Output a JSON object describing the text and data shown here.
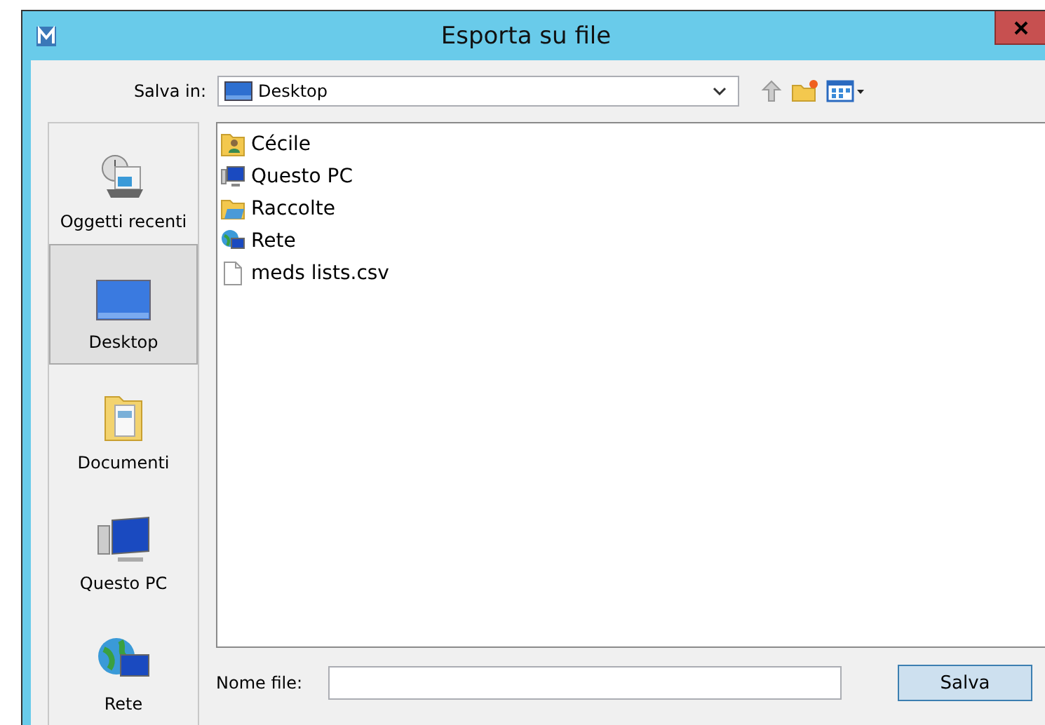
{
  "window": {
    "title": "Esporta su file"
  },
  "location": {
    "label": "Salva in:",
    "value": "Desktop"
  },
  "sidebar": {
    "items": [
      {
        "label": "Oggetti recenti",
        "kind": "recent",
        "selected": false
      },
      {
        "label": "Desktop",
        "kind": "desktop",
        "selected": true
      },
      {
        "label": "Documenti",
        "kind": "documents",
        "selected": false
      },
      {
        "label": "Questo PC",
        "kind": "computer",
        "selected": false
      },
      {
        "label": "Rete",
        "kind": "network",
        "selected": false
      }
    ]
  },
  "files": [
    {
      "name": "Cécile",
      "kind": "user"
    },
    {
      "name": "Questo PC",
      "kind": "computer"
    },
    {
      "name": "Raccolte",
      "kind": "libraries"
    },
    {
      "name": "Rete",
      "kind": "network"
    },
    {
      "name": "meds lists.csv",
      "kind": "file"
    }
  ],
  "filename": {
    "label": "Nome file:"
  },
  "buttons": [
    {
      "label": "Salva",
      "focused": true
    }
  ]
}
